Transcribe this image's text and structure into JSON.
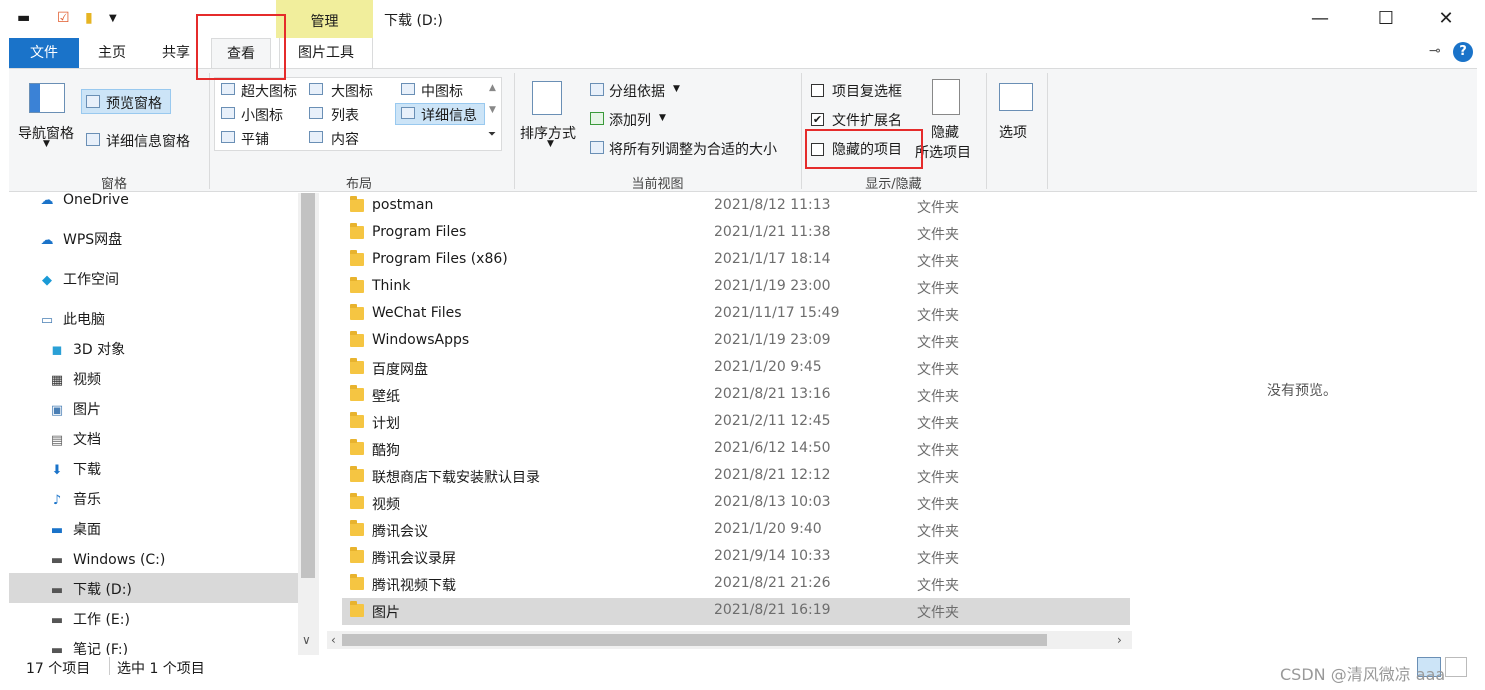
{
  "titlebar": {
    "manage_tab": "管理",
    "title": "下载 (D:)",
    "minimize": "—",
    "maximize": "☐",
    "close": "✕"
  },
  "tabs": {
    "file": "文件",
    "home": "主页",
    "share": "共享",
    "view": "查看",
    "picture_tools": "图片工具"
  },
  "ribbon": {
    "pane": {
      "nav_pane": "导航窗格",
      "preview_pane": "预览窗格",
      "details_pane": "详细信息窗格",
      "group_label": "窗格"
    },
    "layout": {
      "extra_large": "超大图标",
      "large": "大图标",
      "medium": "中图标",
      "small": "小图标",
      "list": "列表",
      "details": "详细信息",
      "tiles": "平铺",
      "content": "内容",
      "group_label": "布局"
    },
    "current_view": {
      "sort_by": "排序方式",
      "group_by": "分组依据",
      "add_columns": "添加列",
      "size_all_columns": "将所有列调整为合适的大小",
      "group_label": "当前视图"
    },
    "show_hide": {
      "item_checkboxes": "项目复选框",
      "file_extensions": "文件扩展名",
      "hidden_items": "隐藏的项目",
      "hide_selected": "隐藏",
      "hide_selected_2": "所选项目",
      "group_label": "显示/隐藏"
    },
    "options": "选项"
  },
  "nav": {
    "items": [
      {
        "label": "OneDrive",
        "icon": "cloud-icon"
      },
      {
        "label": "WPS网盘",
        "icon": "cloud-icon"
      },
      {
        "label": "工作空间",
        "icon": "diamond-icon"
      },
      {
        "label": "此电脑",
        "icon": "computer-icon"
      },
      {
        "label": "3D 对象",
        "icon": "cube-icon"
      },
      {
        "label": "视频",
        "icon": "film-icon"
      },
      {
        "label": "图片",
        "icon": "picture-icon"
      },
      {
        "label": "文档",
        "icon": "document-icon"
      },
      {
        "label": "下载",
        "icon": "download-icon"
      },
      {
        "label": "音乐",
        "icon": "music-icon"
      },
      {
        "label": "桌面",
        "icon": "desktop-icon"
      },
      {
        "label": "Windows (C:)",
        "icon": "drive-icon"
      },
      {
        "label": "下载 (D:)",
        "icon": "drive-icon"
      },
      {
        "label": "工作 (E:)",
        "icon": "drive-icon"
      },
      {
        "label": "笔记 (F:)",
        "icon": "drive-icon"
      }
    ]
  },
  "files": [
    {
      "name": "postman",
      "date": "2021/8/12 11:13",
      "type": "文件夹"
    },
    {
      "name": "Program Files",
      "date": "2021/1/21 11:38",
      "type": "文件夹"
    },
    {
      "name": "Program Files (x86)",
      "date": "2021/1/17 18:14",
      "type": "文件夹"
    },
    {
      "name": "Think",
      "date": "2021/1/19 23:00",
      "type": "文件夹"
    },
    {
      "name": "WeChat Files",
      "date": "2021/11/17 15:49",
      "type": "文件夹"
    },
    {
      "name": "WindowsApps",
      "date": "2021/1/19 23:09",
      "type": "文件夹"
    },
    {
      "name": "百度网盘",
      "date": "2021/1/20 9:45",
      "type": "文件夹"
    },
    {
      "name": "壁纸",
      "date": "2021/8/21 13:16",
      "type": "文件夹"
    },
    {
      "name": "计划",
      "date": "2021/2/11 12:45",
      "type": "文件夹"
    },
    {
      "name": "酷狗",
      "date": "2021/6/12 14:50",
      "type": "文件夹"
    },
    {
      "name": "联想商店下载安装默认目录",
      "date": "2021/8/21 12:12",
      "type": "文件夹"
    },
    {
      "name": "视频",
      "date": "2021/8/13 10:03",
      "type": "文件夹"
    },
    {
      "name": "腾讯会议",
      "date": "2021/1/20 9:40",
      "type": "文件夹"
    },
    {
      "name": "腾讯会议录屏",
      "date": "2021/9/14 10:33",
      "type": "文件夹"
    },
    {
      "name": "腾讯视频下载",
      "date": "2021/8/21 21:26",
      "type": "文件夹"
    },
    {
      "name": "图片",
      "date": "2021/8/21 16:19",
      "type": "文件夹"
    }
  ],
  "preview": {
    "empty_text": "没有预览。"
  },
  "status": {
    "count": "17 个项目",
    "selected": "选中 1 个项目"
  },
  "watermark": "CSDN @清风微凉 aaa",
  "colors": {
    "file_tab": "#1a73c9",
    "manage_band": "#f1ee9c",
    "annotation_red": "#e52b2b",
    "selection": "#d9d9d9"
  }
}
